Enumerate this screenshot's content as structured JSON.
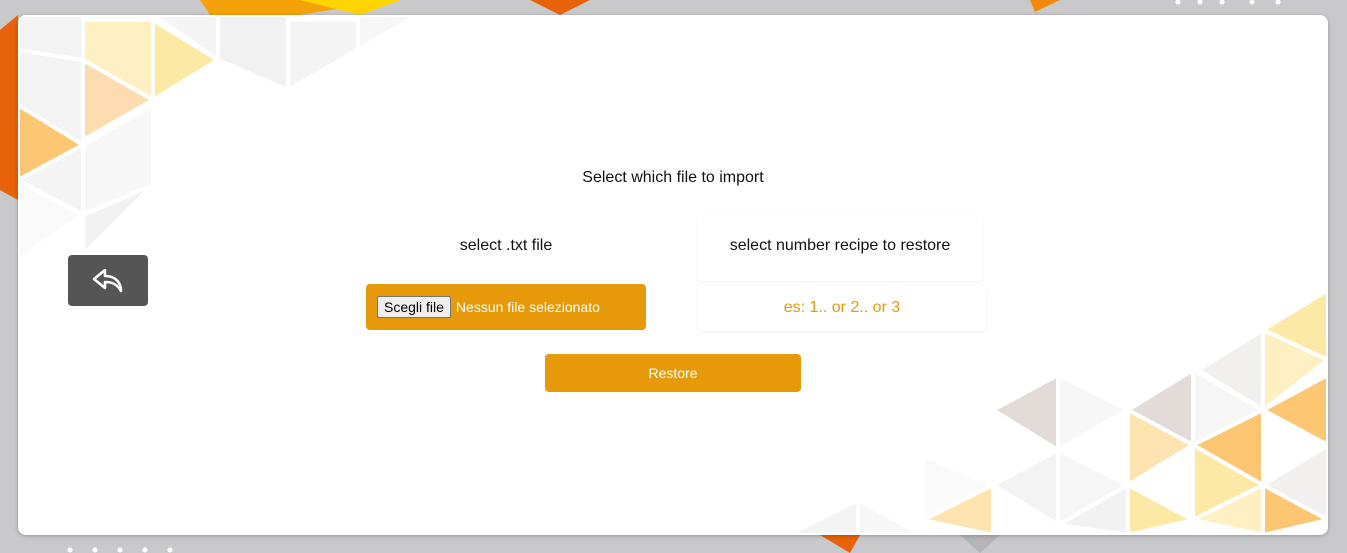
{
  "app": {
    "title": "Select which file to import"
  },
  "nav": {
    "back_icon": "reply-arrow-icon"
  },
  "import": {
    "txt_label": "select .txt file",
    "choose_file_label": "Scegli file",
    "file_status": "Nessun file selezionato",
    "recipe_label": "select number recipe to restore",
    "recipe_placeholder": "es: 1.. or 2.. or 3",
    "restore_label": "Restore"
  },
  "colors": {
    "accent": "#e69a0a",
    "back_button": "#555555",
    "card": "#ffffff",
    "background": "#c9c9cb"
  }
}
